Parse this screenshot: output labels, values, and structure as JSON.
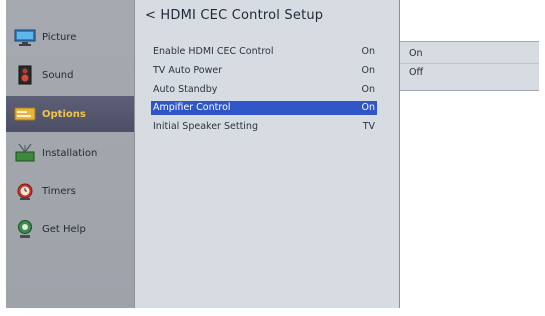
{
  "sidebar": {
    "items": [
      {
        "label": "Picture",
        "icon": "picture-icon"
      },
      {
        "label": "Sound",
        "icon": "speaker-icon"
      },
      {
        "label": "Options",
        "icon": "options-icon",
        "active": true
      },
      {
        "label": "Installation",
        "icon": "antenna-icon"
      },
      {
        "label": "Timers",
        "icon": "alarm-clock-icon"
      },
      {
        "label": "Get Help",
        "icon": "help-icon"
      }
    ]
  },
  "menu": {
    "title": "< HDMI CEC Control Setup",
    "rows": [
      {
        "name": "Enable HDMI CEC  Control",
        "value": "On"
      },
      {
        "name": "TV Auto Power",
        "value": "On"
      },
      {
        "name": "Auto Standby",
        "value": "On"
      },
      {
        "name": "Ampifier Control",
        "value": "On",
        "selected": true
      },
      {
        "name": "Initial Speaker Setting",
        "value": "TV"
      }
    ]
  },
  "dropdown": {
    "options": [
      "On",
      "Off"
    ]
  },
  "colors": {
    "sidebar_bg": "#a6aab0",
    "active_bg": "#5d5f76",
    "active_text": "#f1c64a",
    "menu_bg": "#d7dbe2",
    "selection": "#2f55c8"
  }
}
